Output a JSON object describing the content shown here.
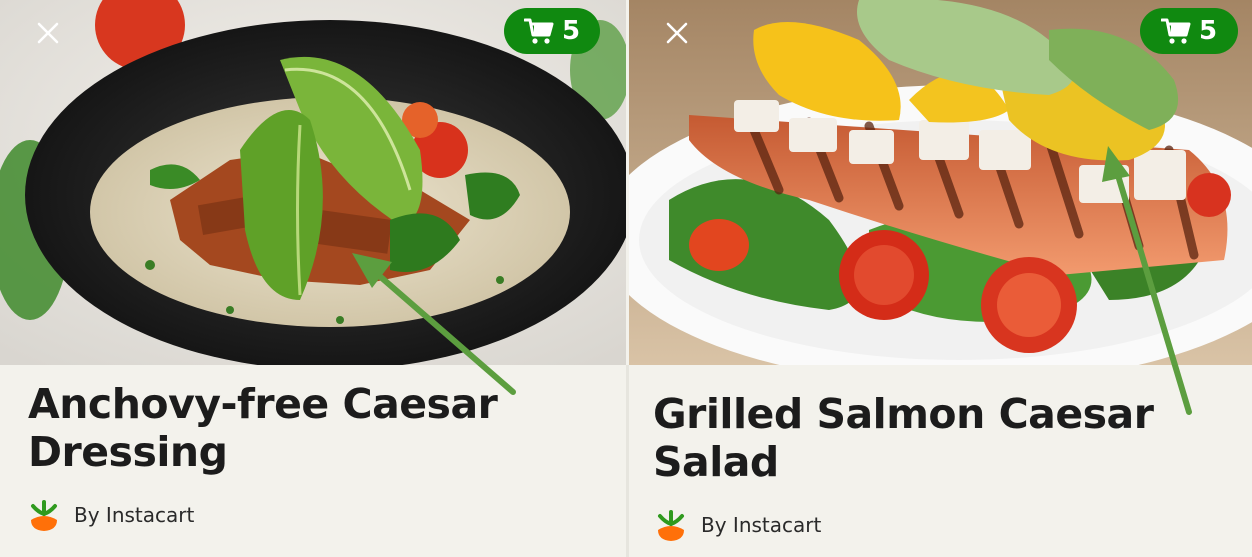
{
  "cards": [
    {
      "title": "Anchovy-free Caesar Dressing",
      "author": "By Instacart",
      "cart_count": "5"
    },
    {
      "title": "Grilled Salmon Caesar Salad",
      "author": "By Instacart",
      "cart_count": "5"
    }
  ],
  "colors": {
    "brand_green": "#108910",
    "annotation_arrow": "#5c9e3f",
    "card_background": "#f3f2ec",
    "logo_orange": "#ff7009"
  },
  "icons": [
    "close-icon",
    "cart-icon",
    "instacart-carrot-icon",
    "annotation-arrow"
  ]
}
